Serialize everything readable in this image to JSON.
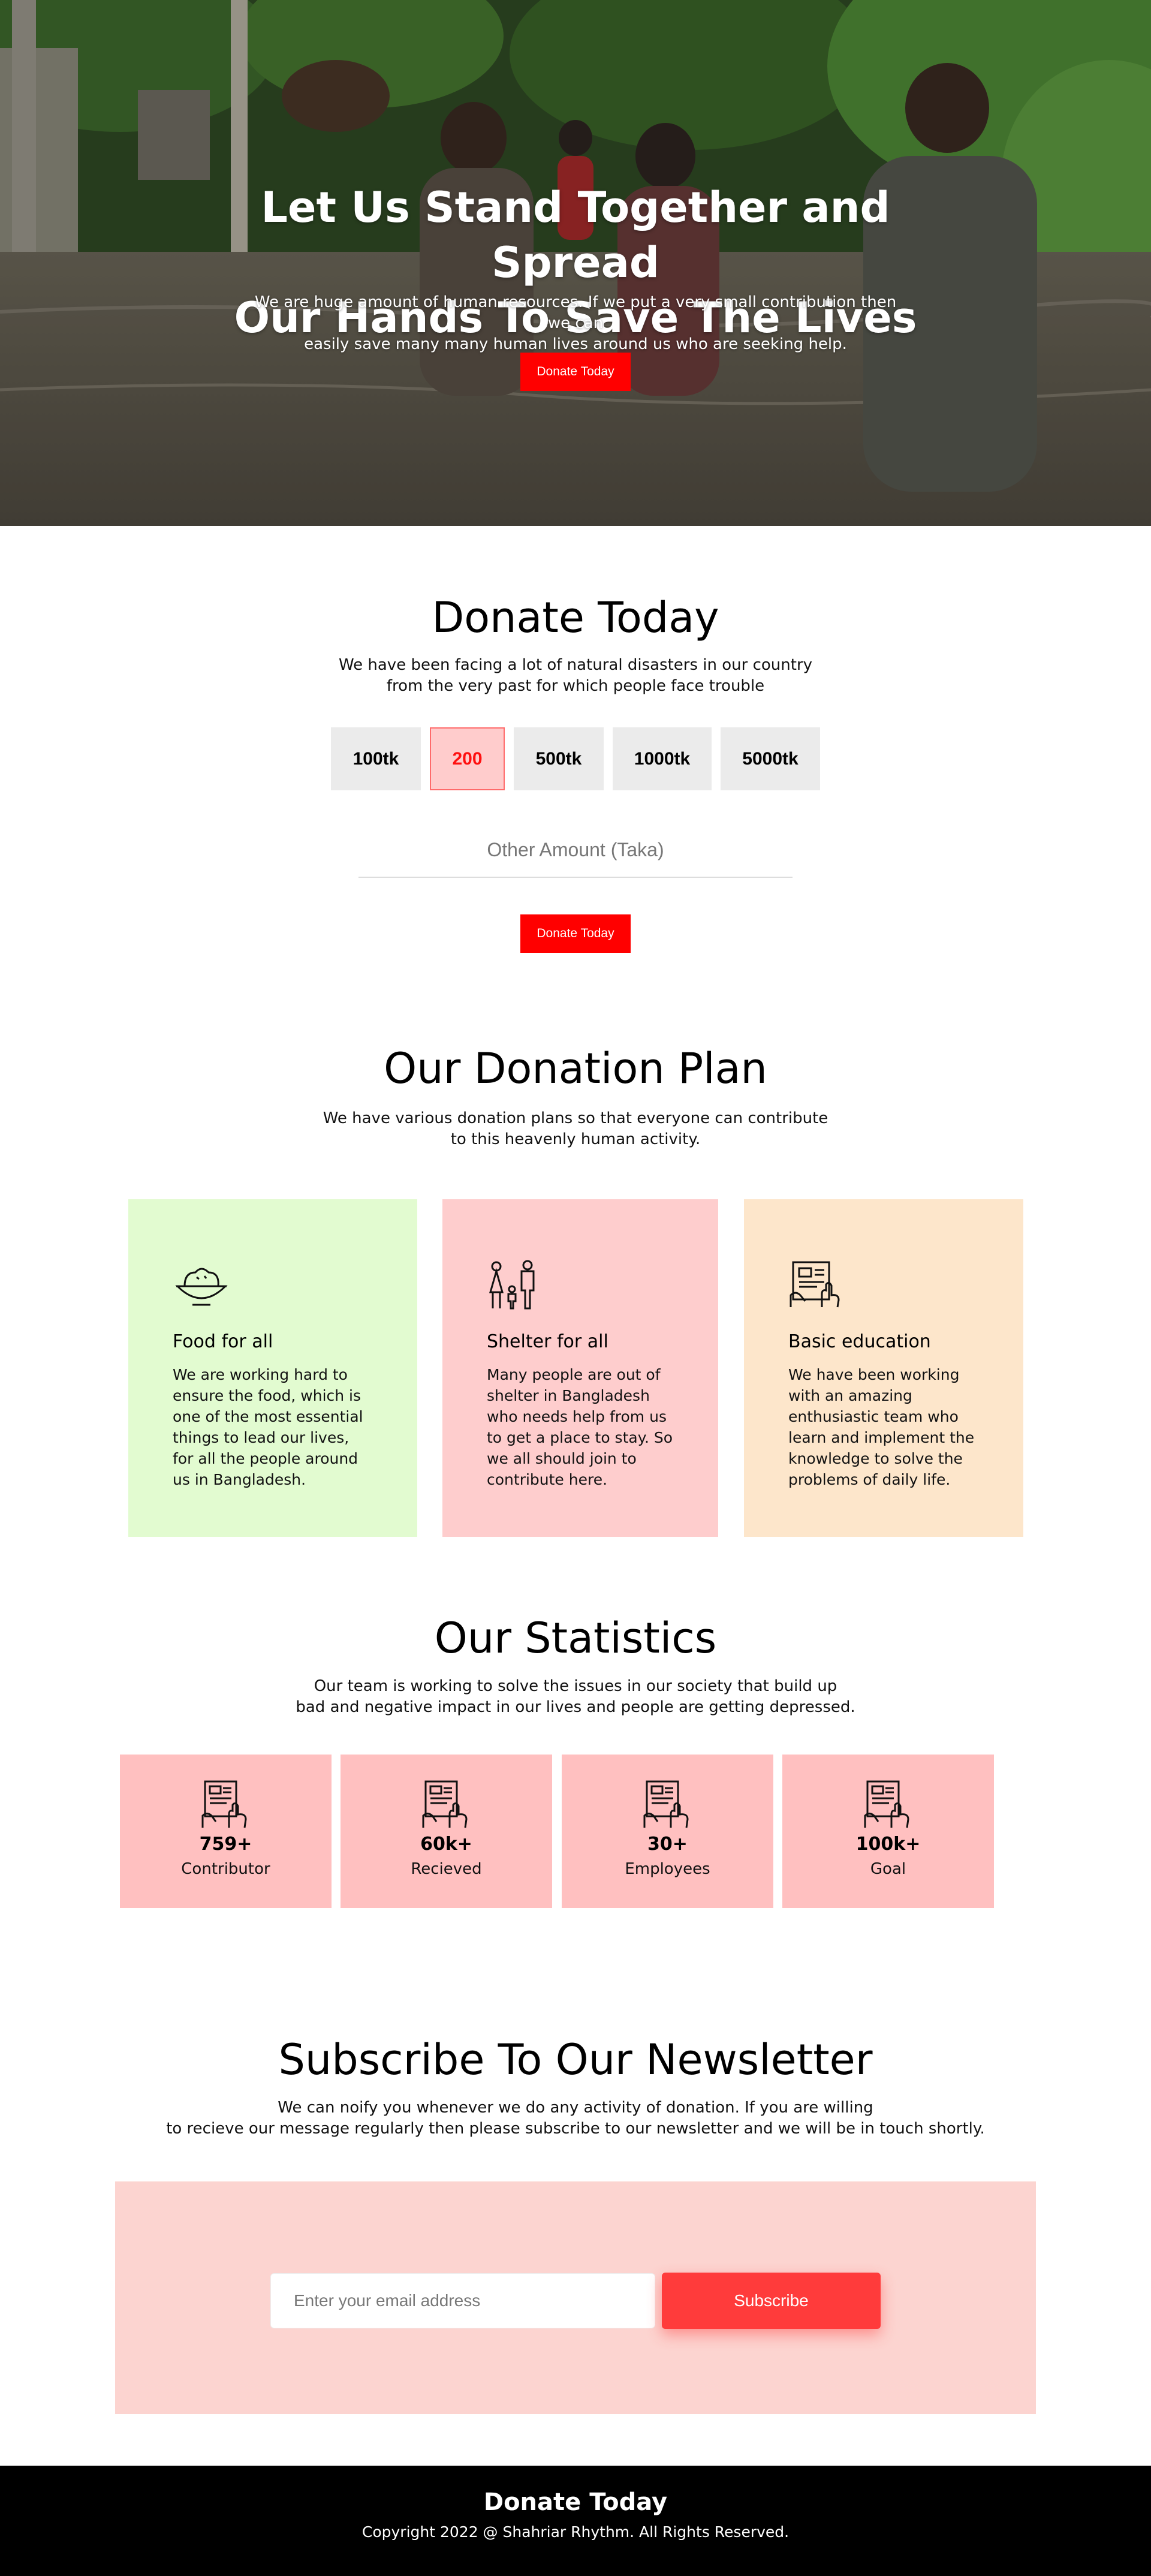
{
  "hero": {
    "title_line1": "Let Us Stand Together and Spread",
    "title_line2": "Our Hands To Save The Lives",
    "subtitle_line1": "We are huge amount of human resources. If we put a very small contribution then we can",
    "subtitle_line2": "easily save many many human lives around us who are seeking help.",
    "button_label": "Donate Today"
  },
  "donate": {
    "title": "Donate Today",
    "subtitle_line1": "We have been facing a lot of natural disasters in our country",
    "subtitle_line2": "from the very past for which people face trouble",
    "amounts": [
      "100tk",
      "200",
      "500tk",
      "1000tk",
      "5000tk"
    ],
    "selected_amount": "200",
    "other_placeholder": "Other Amount (Taka)",
    "button_label": "Donate Today"
  },
  "plan": {
    "title": "Our Donation Plan",
    "subtitle_line1": "We have various donation plans so that everyone can contribute",
    "subtitle_line2": "to this heavenly human activity.",
    "cards": [
      {
        "icon": "food-bowl-icon",
        "title": "Food for all",
        "text": "We are working hard to ensure the food, which is one of the most essential things to lead our lives, for all the people around us in Bangladesh.",
        "color": "#e2fbd0"
      },
      {
        "icon": "family-icon",
        "title": "Shelter for all",
        "text": "Many people are out of shelter in Bangladesh who needs help from us to get a place to stay. So we all should join to contribute here.",
        "color": "#fecdcd"
      },
      {
        "icon": "education-icon",
        "title": "Basic education",
        "text": "We have been working with an amazing enthusiastic team who learn and implement the knowledge to solve the problems of daily life.",
        "color": "#fde6cb"
      }
    ]
  },
  "stats": {
    "title": "Our Statistics",
    "subtitle_line1": "Our team is working to solve the issues in our society that build up",
    "subtitle_line2": "bad and negative impact in our lives and people are getting depressed.",
    "items": [
      {
        "value": "759+",
        "label": "Contributor"
      },
      {
        "value": "60k+",
        "label": "Recieved"
      },
      {
        "value": "30+",
        "label": "Employees"
      },
      {
        "value": "100k+",
        "label": "Goal"
      }
    ]
  },
  "newsletter": {
    "title": "Subscribe To Our Newsletter",
    "subtitle_line1": "We can noify you whenever we do any activity of donation. If you are willing",
    "subtitle_line2": "to recieve our message regularly then please subscribe to our newsletter and we will be in touch shortly.",
    "email_placeholder": "Enter your email address",
    "button_label": "Subscribe"
  },
  "footer": {
    "title": "Donate Today",
    "copyright": "Copyright 2022 @ Shahriar Rhythm. All Rights Reserved."
  },
  "colors": {
    "accent": "#ff0000",
    "subscribe": "#ff3b3b",
    "stat_card": "#ffc0c0",
    "newsletter_box": "#fcd4d0"
  }
}
